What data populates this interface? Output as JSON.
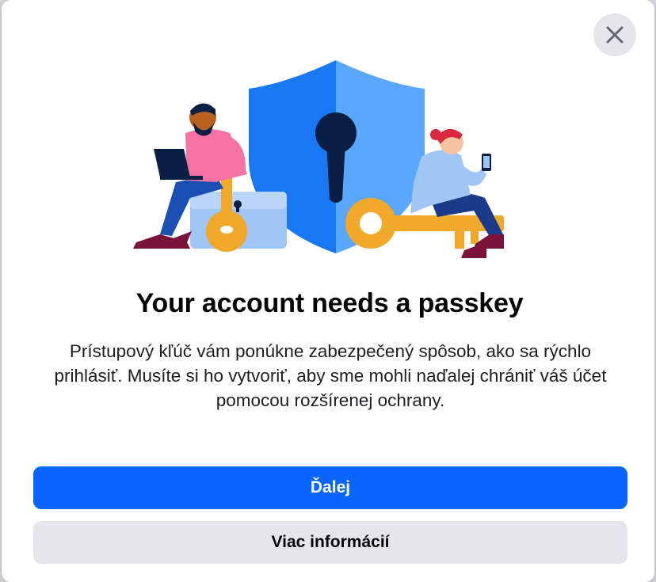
{
  "dialog": {
    "title": "Your account needs a passkey",
    "description": "Prístupový kľúč vám ponúkne zabezpečený spôsob, ako sa rýchlo prihlásiť. Musíte si ho vytvoriť, aby sme mohli naďalej chrániť váš účet pomocou rozšírenej ochrany.",
    "primary_button_label": "Ďalej",
    "secondary_button_label": "Viac informácií",
    "close_icon": "close-icon",
    "illustration_icon": "shield-keyhole-illustration"
  },
  "colors": {
    "primary": "#0866ff",
    "secondary_bg": "#e4e6eb",
    "shield_left": "#1877f2",
    "shield_right": "#5aa7ff",
    "key": "#f0a92a"
  }
}
